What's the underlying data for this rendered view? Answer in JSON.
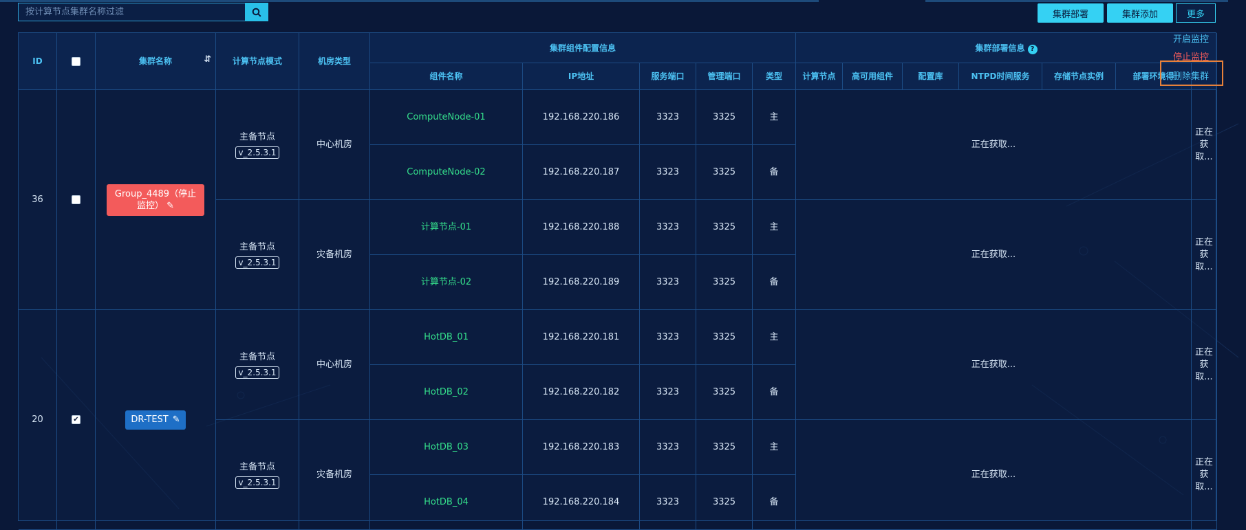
{
  "search": {
    "placeholder": "按计算节点集群名称过滤"
  },
  "toolbar": {
    "deploy": "集群部署",
    "add": "集群添加",
    "more": "更多"
  },
  "more_menu": {
    "start": "开启监控",
    "stop": "停止监控",
    "delete": "删除集群"
  },
  "colors": {
    "accent": "#35d1f3",
    "danger": "#f35b5b",
    "highlight": "#e7813a",
    "green": "#35e08c"
  },
  "table": {
    "headers": {
      "id": "ID",
      "cluster_name": "集群名称",
      "mode": "计算节点模式",
      "room_type": "机房类型",
      "component_group": "集群组件配置信息",
      "deploy_group": "集群部署信息",
      "component_name": "组件名称",
      "ip": "IP地址",
      "service_port": "服务端口",
      "manage_port": "管理端口",
      "type": "类型",
      "compute_node": "计算节点",
      "ha": "高可用组件",
      "config_db": "配置库",
      "ntpd": "NTPD时间服务",
      "storage": "存储节点实例",
      "env": "部署环境得"
    },
    "loading": "正在获取...",
    "loading_short": "正在获取...",
    "clusters": [
      {
        "id": "36",
        "checked": false,
        "name": "Group_4489（停止监控）",
        "groups": [
          {
            "mode": "主备节点",
            "version": "v_2.5.3.1",
            "room": "中心机房",
            "rows": [
              {
                "name": "ComputeNode-01",
                "ip": "192.168.220.186",
                "sport": "3323",
                "mport": "3325",
                "type": "主"
              },
              {
                "name": "ComputeNode-02",
                "ip": "192.168.220.187",
                "sport": "3323",
                "mport": "3325",
                "type": "备"
              }
            ]
          },
          {
            "mode": "主备节点",
            "version": "v_2.5.3.1",
            "room": "灾备机房",
            "rows": [
              {
                "name": "计算节点-01",
                "ip": "192.168.220.188",
                "sport": "3323",
                "mport": "3325",
                "type": "主"
              },
              {
                "name": "计算节点-02",
                "ip": "192.168.220.189",
                "sport": "3323",
                "mport": "3325",
                "type": "备"
              }
            ]
          }
        ]
      },
      {
        "id": "20",
        "checked": true,
        "name": "DR-TEST",
        "groups": [
          {
            "mode": "主备节点",
            "version": "v_2.5.3.1",
            "room": "中心机房",
            "rows": [
              {
                "name": "HotDB_01",
                "ip": "192.168.220.181",
                "sport": "3323",
                "mport": "3325",
                "type": "主"
              },
              {
                "name": "HotDB_02",
                "ip": "192.168.220.182",
                "sport": "3323",
                "mport": "3325",
                "type": "备"
              }
            ]
          },
          {
            "mode": "主备节点",
            "version": "v_2.5.3.1",
            "room": "灾备机房",
            "rows": [
              {
                "name": "HotDB_03",
                "ip": "192.168.220.183",
                "sport": "3323",
                "mport": "3325",
                "type": "主"
              },
              {
                "name": "HotDB_04",
                "ip": "192.168.220.184",
                "sport": "3323",
                "mport": "3325",
                "type": "备"
              }
            ]
          }
        ]
      }
    ]
  }
}
